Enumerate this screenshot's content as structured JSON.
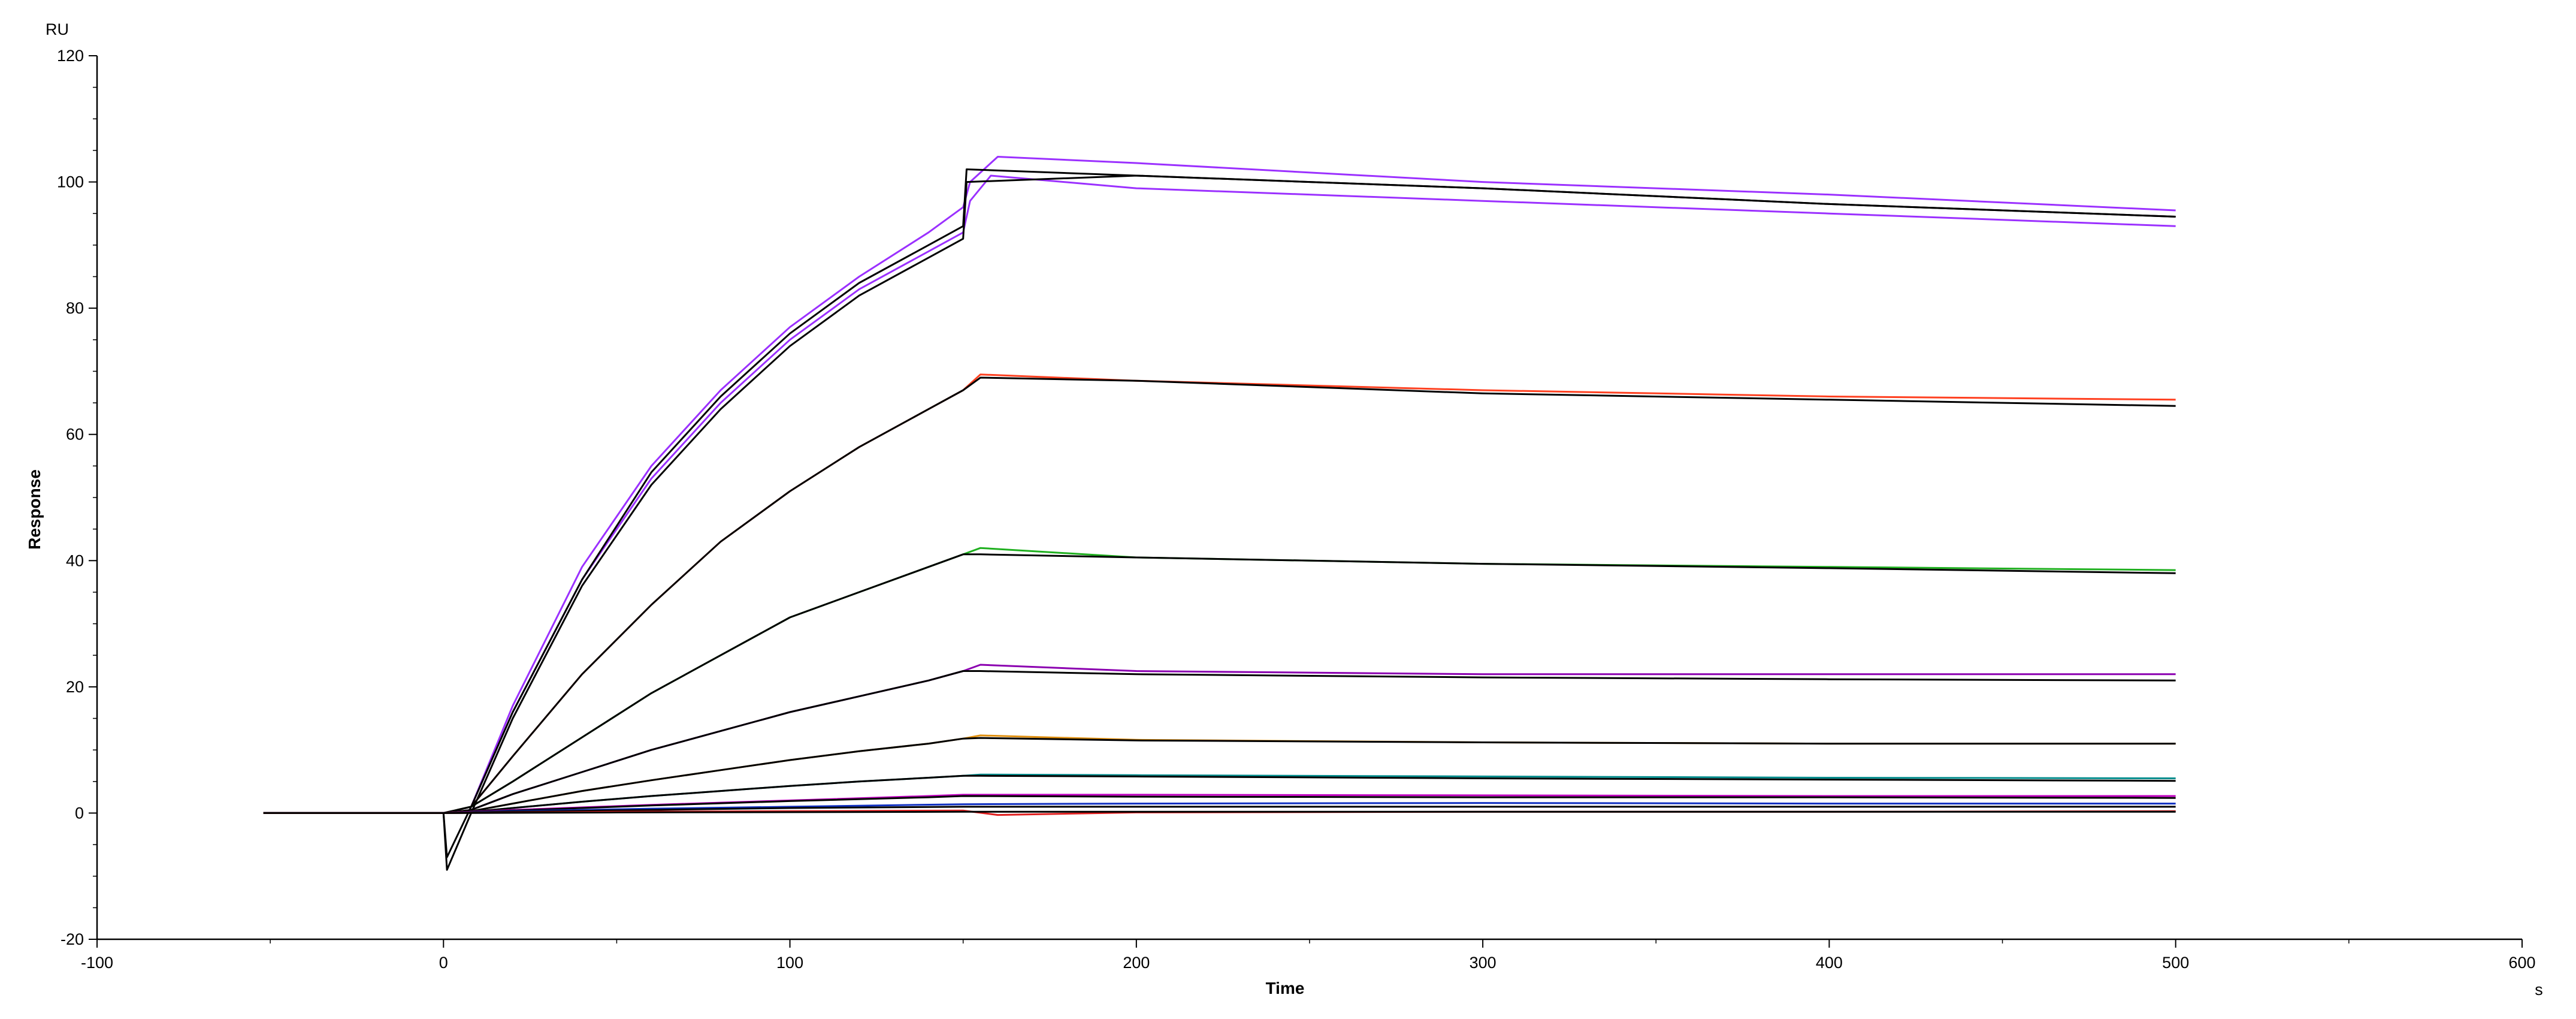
{
  "chart_data": {
    "type": "line",
    "title": "",
    "xlabel": "Time",
    "ylabel": "Response",
    "x_unit": "s",
    "y_unit": "RU",
    "xlim": [
      -100,
      600
    ],
    "ylim": [
      -20,
      120
    ],
    "x_ticks": [
      -100,
      0,
      100,
      200,
      300,
      400,
      500,
      600
    ],
    "y_ticks": [
      -20,
      0,
      20,
      40,
      60,
      80,
      100,
      120
    ],
    "x_tick_labels": [
      "-100",
      "0",
      "100",
      "200",
      "300",
      "400",
      "500",
      "600"
    ],
    "y_tick_labels": [
      "-20",
      "0",
      "20",
      "40",
      "60",
      "80",
      "100",
      "120"
    ],
    "grid": false,
    "legend": "none",
    "series": [
      {
        "color": "#9b30ff",
        "points": [
          [
            -52,
            0
          ],
          [
            0,
            0
          ],
          [
            8,
            1
          ],
          [
            20,
            17
          ],
          [
            40,
            39
          ],
          [
            60,
            55
          ],
          [
            80,
            67
          ],
          [
            100,
            77
          ],
          [
            120,
            85
          ],
          [
            140,
            92
          ],
          [
            150,
            96
          ],
          [
            152,
            100
          ],
          [
            160,
            104
          ],
          [
            200,
            103
          ],
          [
            300,
            100
          ],
          [
            400,
            98
          ],
          [
            500,
            95.5
          ]
        ]
      },
      {
        "color": "#9b30ff",
        "points": [
          [
            -52,
            0
          ],
          [
            0,
            0
          ],
          [
            8,
            1
          ],
          [
            20,
            16
          ],
          [
            40,
            37
          ],
          [
            60,
            53
          ],
          [
            80,
            65
          ],
          [
            100,
            75
          ],
          [
            120,
            83
          ],
          [
            140,
            89
          ],
          [
            150,
            92
          ],
          [
            152,
            97
          ],
          [
            158,
            101
          ],
          [
            200,
            99
          ],
          [
            300,
            97
          ],
          [
            400,
            95
          ],
          [
            500,
            93
          ]
        ]
      },
      {
        "color": "#000000",
        "points": [
          [
            -52,
            0
          ],
          [
            0,
            0
          ],
          [
            1,
            -7
          ],
          [
            8,
            1
          ],
          [
            20,
            16
          ],
          [
            40,
            37
          ],
          [
            60,
            54
          ],
          [
            80,
            66
          ],
          [
            100,
            76
          ],
          [
            120,
            84
          ],
          [
            140,
            90
          ],
          [
            150,
            93
          ],
          [
            151,
            102
          ],
          [
            200,
            101
          ],
          [
            300,
            99
          ],
          [
            400,
            96.5
          ],
          [
            500,
            94.5
          ]
        ]
      },
      {
        "color": "#000000",
        "points": [
          [
            -52,
            0
          ],
          [
            0,
            0
          ],
          [
            1,
            -9
          ],
          [
            8,
            0
          ],
          [
            20,
            15
          ],
          [
            40,
            36
          ],
          [
            60,
            52
          ],
          [
            80,
            64
          ],
          [
            100,
            74
          ],
          [
            120,
            82
          ],
          [
            140,
            88
          ],
          [
            150,
            91
          ],
          [
            151,
            100
          ],
          [
            200,
            101
          ],
          [
            300,
            99
          ],
          [
            400,
            96.5
          ],
          [
            500,
            94.5
          ]
        ]
      },
      {
        "color": "#ff4020",
        "points": [
          [
            -52,
            0
          ],
          [
            0,
            0
          ],
          [
            8,
            1
          ],
          [
            20,
            9
          ],
          [
            40,
            22
          ],
          [
            60,
            33
          ],
          [
            80,
            43
          ],
          [
            100,
            51
          ],
          [
            120,
            58
          ],
          [
            140,
            64
          ],
          [
            150,
            67
          ],
          [
            155,
            69.5
          ],
          [
            200,
            68.5
          ],
          [
            300,
            67
          ],
          [
            400,
            66
          ],
          [
            500,
            65.5
          ]
        ]
      },
      {
        "color": "#000000",
        "points": [
          [
            -52,
            0
          ],
          [
            0,
            0
          ],
          [
            8,
            1
          ],
          [
            20,
            9
          ],
          [
            40,
            22
          ],
          [
            60,
            33
          ],
          [
            80,
            43
          ],
          [
            100,
            51
          ],
          [
            120,
            58
          ],
          [
            140,
            64
          ],
          [
            150,
            67
          ],
          [
            155,
            69
          ],
          [
            200,
            68.5
          ],
          [
            300,
            66.5
          ],
          [
            400,
            65.5
          ],
          [
            500,
            64.5
          ]
        ]
      },
      {
        "color": "#20b020",
        "points": [
          [
            -52,
            0
          ],
          [
            0,
            0
          ],
          [
            8,
            1
          ],
          [
            20,
            5
          ],
          [
            40,
            12
          ],
          [
            60,
            19
          ],
          [
            80,
            25
          ],
          [
            100,
            31
          ],
          [
            120,
            35
          ],
          [
            140,
            39
          ],
          [
            150,
            41
          ],
          [
            155,
            42
          ],
          [
            200,
            40.5
          ],
          [
            300,
            39.5
          ],
          [
            400,
            39
          ],
          [
            500,
            38.5
          ]
        ]
      },
      {
        "color": "#000000",
        "points": [
          [
            -52,
            0
          ],
          [
            0,
            0
          ],
          [
            8,
            1
          ],
          [
            20,
            5
          ],
          [
            40,
            12
          ],
          [
            60,
            19
          ],
          [
            80,
            25
          ],
          [
            100,
            31
          ],
          [
            120,
            35
          ],
          [
            140,
            39
          ],
          [
            150,
            41
          ],
          [
            155,
            41
          ],
          [
            200,
            40.5
          ],
          [
            300,
            39.5
          ],
          [
            400,
            38.8
          ],
          [
            500,
            38
          ]
        ]
      },
      {
        "color": "#8b00b0",
        "points": [
          [
            -52,
            0
          ],
          [
            0,
            0
          ],
          [
            8,
            0.5
          ],
          [
            20,
            3
          ],
          [
            40,
            6.5
          ],
          [
            60,
            10
          ],
          [
            80,
            13
          ],
          [
            100,
            16
          ],
          [
            120,
            18.5
          ],
          [
            140,
            21
          ],
          [
            150,
            22.5
          ],
          [
            155,
            23.5
          ],
          [
            200,
            22.5
          ],
          [
            300,
            22
          ],
          [
            400,
            22
          ],
          [
            500,
            22
          ]
        ]
      },
      {
        "color": "#000000",
        "points": [
          [
            -52,
            0
          ],
          [
            0,
            0
          ],
          [
            8,
            0.5
          ],
          [
            20,
            3
          ],
          [
            40,
            6.5
          ],
          [
            60,
            10
          ],
          [
            80,
            13
          ],
          [
            100,
            16
          ],
          [
            120,
            18.5
          ],
          [
            140,
            21
          ],
          [
            150,
            22.5
          ],
          [
            155,
            22.5
          ],
          [
            200,
            22
          ],
          [
            300,
            21.5
          ],
          [
            400,
            21.2
          ],
          [
            500,
            21
          ]
        ]
      },
      {
        "color": "#e09010",
        "points": [
          [
            -52,
            0
          ],
          [
            0,
            0
          ],
          [
            8,
            0.3
          ],
          [
            20,
            1.5
          ],
          [
            40,
            3.5
          ],
          [
            60,
            5.2
          ],
          [
            80,
            6.8
          ],
          [
            100,
            8.4
          ],
          [
            120,
            9.8
          ],
          [
            140,
            11
          ],
          [
            150,
            11.8
          ],
          [
            155,
            12.3
          ],
          [
            200,
            11.6
          ],
          [
            300,
            11.2
          ],
          [
            400,
            11
          ],
          [
            500,
            11
          ]
        ]
      },
      {
        "color": "#000000",
        "points": [
          [
            -52,
            0
          ],
          [
            0,
            0
          ],
          [
            8,
            0.3
          ],
          [
            20,
            1.5
          ],
          [
            40,
            3.5
          ],
          [
            60,
            5.2
          ],
          [
            80,
            6.8
          ],
          [
            100,
            8.4
          ],
          [
            120,
            9.8
          ],
          [
            140,
            11
          ],
          [
            150,
            11.8
          ],
          [
            155,
            11.9
          ],
          [
            200,
            11.5
          ],
          [
            300,
            11.2
          ],
          [
            400,
            11
          ],
          [
            500,
            11
          ]
        ]
      },
      {
        "color": "#008b8b",
        "points": [
          [
            -52,
            0
          ],
          [
            0,
            0
          ],
          [
            8,
            0.2
          ],
          [
            20,
            0.8
          ],
          [
            40,
            1.8
          ],
          [
            60,
            2.7
          ],
          [
            80,
            3.5
          ],
          [
            100,
            4.3
          ],
          [
            120,
            5
          ],
          [
            140,
            5.6
          ],
          [
            150,
            5.9
          ],
          [
            155,
            6.1
          ],
          [
            200,
            6
          ],
          [
            300,
            5.8
          ],
          [
            400,
            5.6
          ],
          [
            500,
            5.5
          ]
        ]
      },
      {
        "color": "#000000",
        "points": [
          [
            -52,
            0
          ],
          [
            0,
            0
          ],
          [
            8,
            0.2
          ],
          [
            20,
            0.8
          ],
          [
            40,
            1.8
          ],
          [
            60,
            2.7
          ],
          [
            80,
            3.5
          ],
          [
            100,
            4.3
          ],
          [
            120,
            5
          ],
          [
            140,
            5.6
          ],
          [
            150,
            5.9
          ],
          [
            155,
            5.9
          ],
          [
            200,
            5.8
          ],
          [
            300,
            5.5
          ],
          [
            400,
            5.3
          ],
          [
            500,
            5.1
          ]
        ]
      },
      {
        "color": "#c000c0",
        "points": [
          [
            -52,
            0
          ],
          [
            0,
            0
          ],
          [
            20,
            0.5
          ],
          [
            60,
            1.3
          ],
          [
            100,
            2
          ],
          [
            140,
            2.7
          ],
          [
            150,
            2.9
          ],
          [
            200,
            2.9
          ],
          [
            300,
            2.8
          ],
          [
            400,
            2.7
          ],
          [
            500,
            2.7
          ]
        ]
      },
      {
        "color": "#000000",
        "points": [
          [
            -52,
            0
          ],
          [
            0,
            0
          ],
          [
            20,
            0.4
          ],
          [
            60,
            1.2
          ],
          [
            100,
            1.9
          ],
          [
            140,
            2.5
          ],
          [
            150,
            2.7
          ],
          [
            200,
            2.6
          ],
          [
            300,
            2.5
          ],
          [
            400,
            2.5
          ],
          [
            500,
            2.4
          ]
        ]
      },
      {
        "color": "#1030c0",
        "points": [
          [
            -52,
            0
          ],
          [
            0,
            0
          ],
          [
            20,
            0.3
          ],
          [
            60,
            0.7
          ],
          [
            100,
            1
          ],
          [
            150,
            1.4
          ],
          [
            200,
            1.5
          ],
          [
            300,
            1.6
          ],
          [
            400,
            1.5
          ],
          [
            500,
            1.5
          ]
        ]
      },
      {
        "color": "#000000",
        "points": [
          [
            -52,
            0
          ],
          [
            0,
            0
          ],
          [
            20,
            0.2
          ],
          [
            60,
            0.5
          ],
          [
            100,
            0.8
          ],
          [
            150,
            1
          ],
          [
            200,
            1
          ],
          [
            300,
            1
          ],
          [
            400,
            1
          ],
          [
            500,
            1
          ]
        ]
      },
      {
        "color": "#e02020",
        "points": [
          [
            -52,
            0
          ],
          [
            0,
            0
          ],
          [
            50,
            0.2
          ],
          [
            150,
            0.4
          ],
          [
            160,
            -0.3
          ],
          [
            200,
            0.1
          ],
          [
            300,
            0.2
          ],
          [
            400,
            0.2
          ],
          [
            500,
            0.3
          ]
        ]
      },
      {
        "color": "#000000",
        "points": [
          [
            -52,
            0
          ],
          [
            0,
            0
          ],
          [
            50,
            0.1
          ],
          [
            150,
            0.2
          ],
          [
            200,
            0.2
          ],
          [
            300,
            0.2
          ],
          [
            400,
            0.2
          ],
          [
            500,
            0.2
          ]
        ]
      }
    ]
  }
}
